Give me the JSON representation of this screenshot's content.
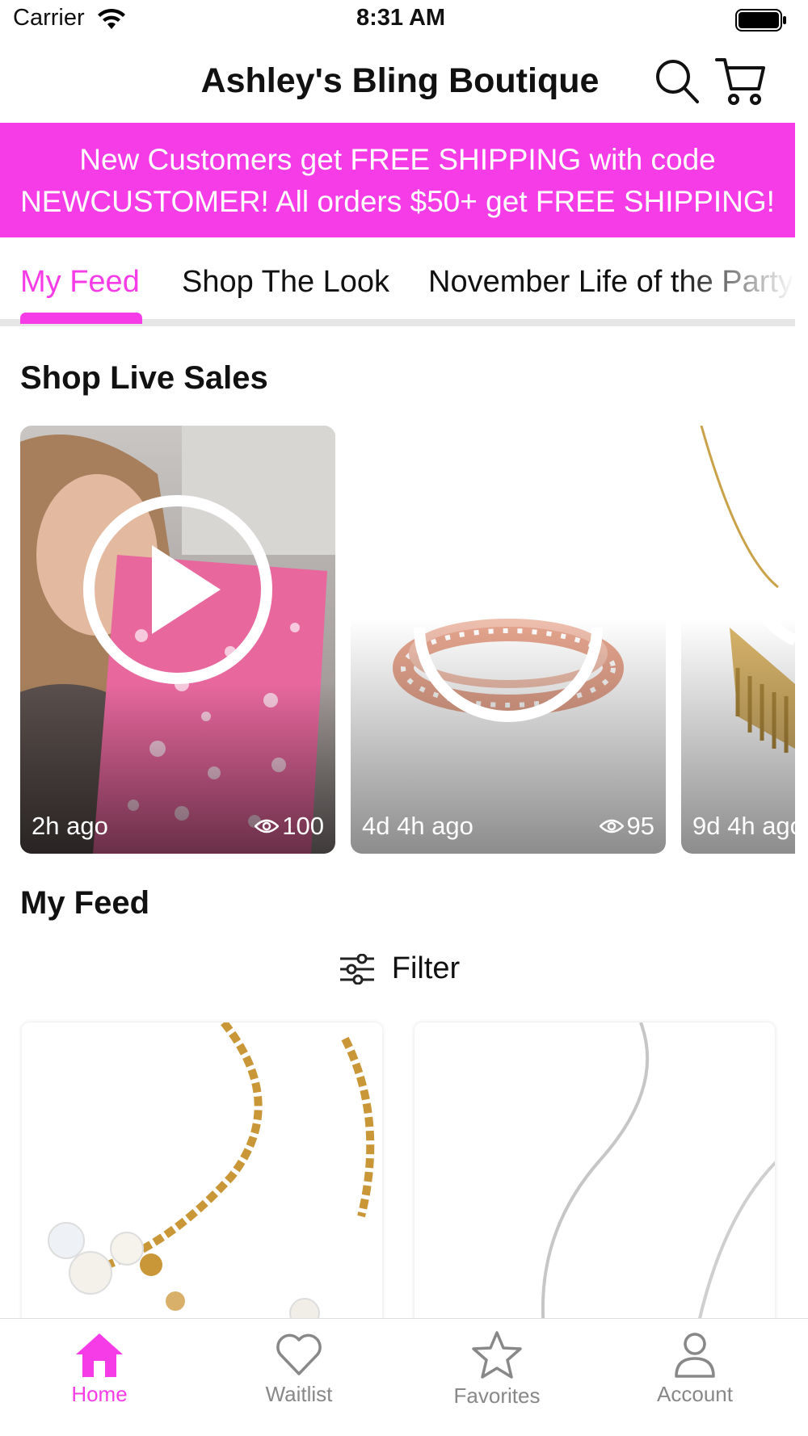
{
  "status_bar": {
    "carrier": "Carrier",
    "time": "8:31 AM"
  },
  "header": {
    "title": "Ashley's Bling Boutique",
    "search_icon": "search-icon",
    "cart_icon": "cart-icon"
  },
  "banner": {
    "line1": "New Customers get FREE SHIPPING with code",
    "line2": "NEWCUSTOMER! All orders $50+ get FREE SHIPPING!",
    "color": "#f53ce6"
  },
  "tabs": [
    {
      "label": "My Feed",
      "active": true
    },
    {
      "label": "Shop The Look",
      "active": false
    },
    {
      "label": "November Life of the Party",
      "active": false
    }
  ],
  "live_sales": {
    "title": "Shop Live Sales",
    "cards": [
      {
        "time": "2h ago",
        "views": "100",
        "subject": "woman holding pink snowflake bag"
      },
      {
        "time": "4d 4h ago",
        "views": "95",
        "subject": "rose gold rhinestone bracelet"
      },
      {
        "time": "9d 4h ago",
        "views": "",
        "subject": "gold necklace"
      }
    ]
  },
  "feed": {
    "title": "My Feed",
    "filter_label": "Filter",
    "items": [
      {
        "subject": "gold chain pearl necklace"
      },
      {
        "subject": "silver chain necklace"
      }
    ]
  },
  "tabbar": [
    {
      "label": "Home",
      "icon": "home-icon",
      "active": true
    },
    {
      "label": "Waitlist",
      "icon": "heart-icon",
      "active": false
    },
    {
      "label": "Favorites",
      "icon": "star-icon",
      "active": false
    },
    {
      "label": "Account",
      "icon": "person-icon",
      "active": false
    }
  ],
  "colors": {
    "accent": "#f53ce6",
    "inactive": "#888888"
  }
}
